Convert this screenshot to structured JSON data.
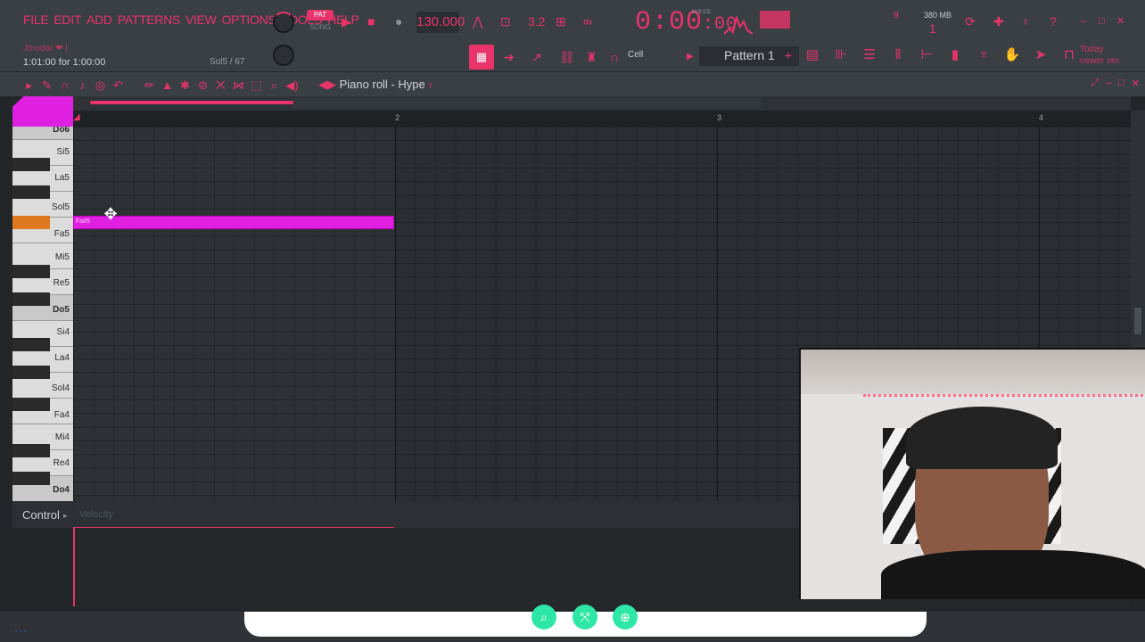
{
  "menu": [
    "FILE",
    "EDIT",
    "ADD",
    "PATTERNS",
    "VIEW",
    "OPTIONS",
    "TOOLS",
    "HELP"
  ],
  "hint_text": "Jmudar ❤ |",
  "time_info": "1:01:00 for 1:00:00",
  "step_info": "Sol5 / 67",
  "pat_label": "PAT",
  "song_label": "SONG",
  "tempo": "130.000",
  "clock_main": "0:00",
  "clock_sub": ":00",
  "clock_unit": "M:S:CS",
  "memory": "380 MB",
  "memory_count": "1",
  "cpu_value": "9",
  "update_notice": [
    "Today",
    "newer ver."
  ],
  "cell_label": "Cell",
  "pattern_name": "Pattern 1",
  "piano_roll": {
    "title_prefix": "Piano roll",
    "title_name": "Hype"
  },
  "bars": [
    "2",
    "3",
    "4"
  ],
  "keys": [
    "Do6",
    "Si5",
    "La5",
    "Sol5",
    "Fa5",
    "Mi5",
    "Re5",
    "Do5",
    "Si4",
    "La4",
    "Sol4",
    "Fa4",
    "Mi4",
    "Re4",
    "Do4"
  ],
  "note": {
    "label": "Fa#5",
    "pitch": "Fa#5",
    "start_bar": 1,
    "length_bars": 1
  },
  "control": {
    "label": "Control",
    "target": "Velocity"
  },
  "colors": {
    "accent": "#e8336b",
    "note": "#e020e0",
    "highlight_key": "#e07820",
    "zoom_buttons": "#2ee6a6"
  },
  "icons": [
    "search-icon",
    "zoom-fit-icon",
    "zoom-in-icon"
  ]
}
